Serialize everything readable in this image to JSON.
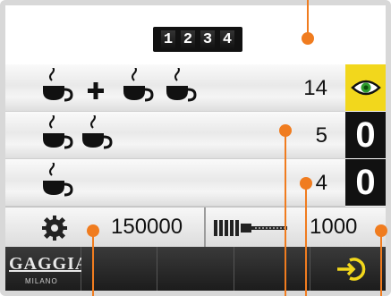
{
  "counter": {
    "digits": [
      "1",
      "2",
      "3",
      "4"
    ]
  },
  "rows": [
    {
      "label": "double espresso + single espresso",
      "icons": [
        "single-cup-icon",
        "plus-icon",
        "double-cup-icon"
      ],
      "value": "14",
      "side_icon": "eye-icon",
      "side_color": "#f2d71c"
    },
    {
      "label": "double espresso",
      "icons": [
        "double-cup-icon"
      ],
      "value": "5",
      "side_value": "0",
      "side_color": "#111111"
    },
    {
      "label": "single espresso",
      "icons": [
        "single-cup-icon"
      ],
      "value": "4",
      "side_value": "0",
      "side_color": "#111111"
    }
  ],
  "maintenance": {
    "gear_value": "150000",
    "brush_value": "1000"
  },
  "toolbar": {
    "logo_main": "GAGGIA",
    "logo_sub": "MILANO",
    "buttons": [
      "logo",
      "empty",
      "empty",
      "empty",
      "exit-icon"
    ]
  },
  "accent_color": "#f07c1f"
}
